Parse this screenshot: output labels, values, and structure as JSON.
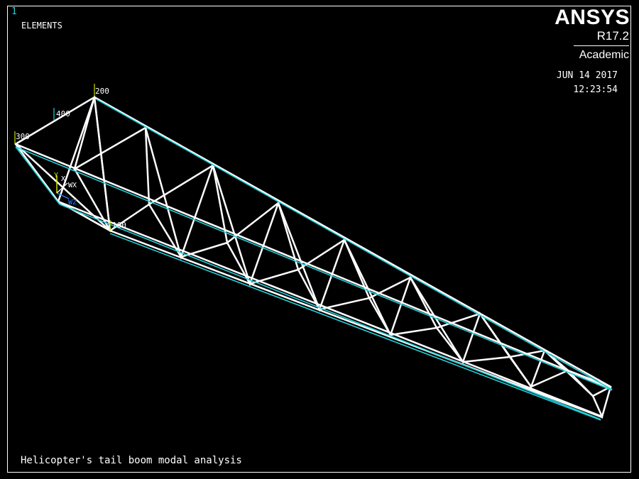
{
  "window": {
    "number": "1",
    "plot_type": "ELEMENTS"
  },
  "branding": {
    "product": "ANSYS",
    "version": "R17.2",
    "edition": "Academic"
  },
  "timestamp": {
    "date": "JUN 14 2017",
    "time": "12:23:54"
  },
  "title": "Helicopter's tail boom modal analysis",
  "keypoints": {
    "a": "200",
    "b": "400",
    "c": "300",
    "d": "100"
  },
  "triad": {
    "y": "Y",
    "x": "X",
    "z": "Z",
    "w": "WX",
    "n": "WZ"
  },
  "colors": {
    "background": "#000000",
    "elements": "#ffffff",
    "edge_highlight": "#22cfd8",
    "window_number": "#22cfd8",
    "triad_y": "#c8e000",
    "triad_z": "#2a7fff"
  }
}
